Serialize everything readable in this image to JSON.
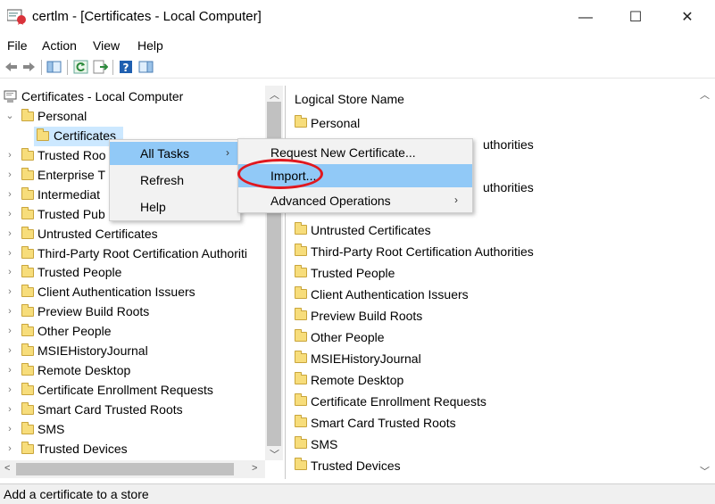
{
  "window": {
    "title": "certlm - [Certificates - Local Computer]",
    "minimize_glyph": "—",
    "maximize_glyph": "☐",
    "close_glyph": "✕"
  },
  "menubar": [
    "File",
    "Action",
    "View",
    "Help"
  ],
  "toolbar": {
    "buttons": [
      "back-arrow-icon",
      "forward-arrow-icon",
      "show-hide-console-tree-icon",
      "refresh-icon",
      "export-list-icon",
      "help-icon",
      "show-action-pane-icon"
    ]
  },
  "tree": {
    "root": "Certificates - Local Computer",
    "personal": "Personal",
    "personal_child": "Certificates",
    "items": [
      "Trusted Roo",
      "Enterprise T",
      "Intermediat",
      "Trusted Pub",
      "Untrusted Certificates",
      "Third-Party Root Certification Authoriti",
      "Trusted People",
      "Client Authentication Issuers",
      "Preview Build Roots",
      "Other People",
      "MSIEHistoryJournal",
      "Remote Desktop",
      "Certificate Enrollment Requests",
      "Smart Card Trusted Roots",
      "SMS",
      "Trusted Devices"
    ]
  },
  "list": {
    "header": "Logical Store Name",
    "items": [
      "Personal",
      "uthorities",
      "uthorities",
      "Untrusted Certificates",
      "Third-Party Root Certification Authorities",
      "Trusted People",
      "Client Authentication Issuers",
      "Preview Build Roots",
      "Other People",
      "MSIEHistoryJournal",
      "Remote Desktop",
      "Certificate Enrollment Requests",
      "Smart Card Trusted Roots",
      "SMS",
      "Trusted Devices"
    ]
  },
  "context_menu": {
    "items": [
      "All Tasks",
      "Refresh",
      "Help"
    ]
  },
  "submenu": {
    "items": [
      "Request New Certificate...",
      "Import...",
      "Advanced Operations"
    ]
  },
  "status": "Add a certificate to a store",
  "colors": {
    "selection": "#cce8ff",
    "menu_hover": "#91c9f7",
    "annotation_red": "#e0181f"
  }
}
